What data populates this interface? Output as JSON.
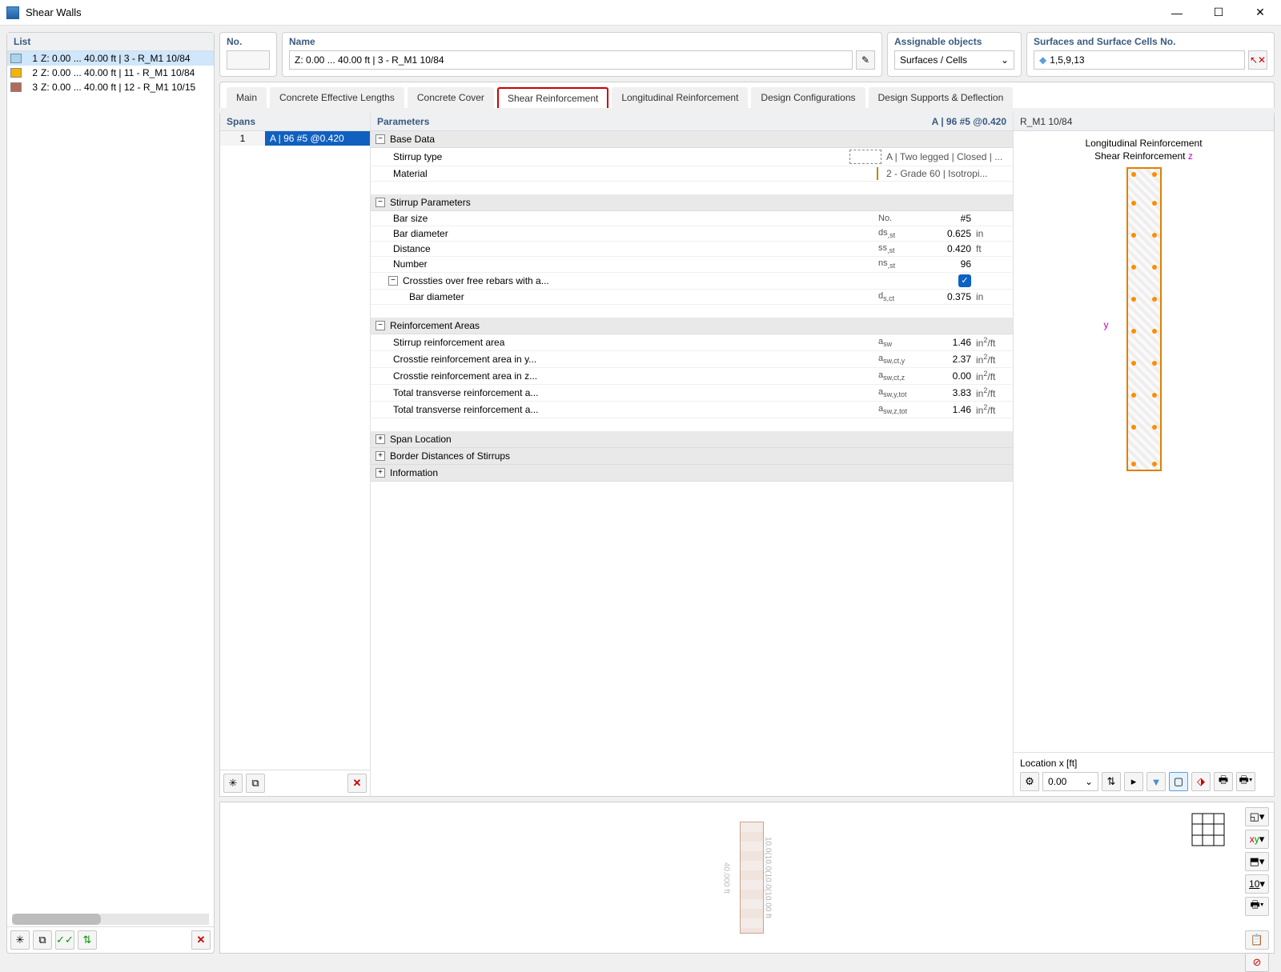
{
  "window": {
    "title": "Shear Walls"
  },
  "list": {
    "header": "List",
    "items": [
      {
        "num": "1",
        "color": "#a8d4f0",
        "label": "Z: 0.00 ... 40.00 ft | 3 - R_M1 10/84",
        "selected": true
      },
      {
        "num": "2",
        "color": "#f5b400",
        "label": "Z: 0.00 ... 40.00 ft | 11 - R_M1 10/84",
        "selected": false
      },
      {
        "num": "3",
        "color": "#b36a58",
        "label": "Z: 0.00 ... 40.00 ft | 12 - R_M1 10/15",
        "selected": false
      }
    ]
  },
  "fields": {
    "no_label": "No.",
    "no_value": "",
    "name_label": "Name",
    "name_value": "Z: 0.00 ... 40.00  ft | 3 - R_M1 10/84",
    "assign_label": "Assignable objects",
    "assign_value": "Surfaces / Cells",
    "surf_label": "Surfaces and Surface Cells No.",
    "surf_value": "1,5,9,13"
  },
  "tabs": [
    "Main",
    "Concrete Effective Lengths",
    "Concrete Cover",
    "Shear Reinforcement",
    "Longitudinal Reinforcement",
    "Design Configurations",
    "Design Supports & Deflection"
  ],
  "active_tab": "Shear Reinforcement",
  "spans": {
    "header": "Spans",
    "rows": [
      {
        "num": "1",
        "value": "A | 96 #5 @0.420"
      }
    ]
  },
  "params": {
    "header": "Parameters",
    "header_right": "A | 96 #5 @0.420",
    "base_data": {
      "title": "Base Data",
      "stirrup_type_label": "Stirrup type",
      "stirrup_type_value": "A | Two legged | Closed | ...",
      "material_label": "Material",
      "material_value": "2 - Grade 60 | Isotropi..."
    },
    "stirrup_params": {
      "title": "Stirrup Parameters",
      "rows": [
        {
          "name": "Bar size",
          "sym": "No.",
          "val": "#5",
          "unit": ""
        },
        {
          "name": "Bar diameter",
          "sym": "ds,st",
          "val": "0.625",
          "unit": "in"
        },
        {
          "name": "Distance",
          "sym": "ss,st",
          "val": "0.420",
          "unit": "ft"
        },
        {
          "name": "Number",
          "sym": "ns,st",
          "val": "96",
          "unit": ""
        }
      ],
      "crossties_label": "Crossties over free rebars with a...",
      "crossties_bar_label": "Bar diameter",
      "crossties_bar_sym": "ds,ct",
      "crossties_bar_val": "0.375",
      "crossties_bar_unit": "in"
    },
    "reinf_areas": {
      "title": "Reinforcement Areas",
      "rows": [
        {
          "name": "Stirrup reinforcement area",
          "sym": "asw",
          "val": "1.46",
          "unit": "in²/ft"
        },
        {
          "name": "Crosstie reinforcement area in y...",
          "sym": "asw,ct,y",
          "val": "2.37",
          "unit": "in²/ft"
        },
        {
          "name": "Crosstie reinforcement area in z...",
          "sym": "asw,ct,z",
          "val": "0.00",
          "unit": "in²/ft"
        },
        {
          "name": "Total transverse reinforcement a...",
          "sym": "asw,y,tot",
          "val": "3.83",
          "unit": "in²/ft"
        },
        {
          "name": "Total transverse reinforcement a...",
          "sym": "asw,z,tot",
          "val": "1.46",
          "unit": "in²/ft"
        }
      ]
    },
    "collapsed": [
      "Span Location",
      "Border Distances of Stirrups",
      "Information"
    ]
  },
  "preview": {
    "title": "R_M1 10/84",
    "label1": "Longitudinal Reinforcement",
    "label2": "Shear Reinforcement",
    "axis_z": "z",
    "axis_y": "y",
    "location_label": "Location x [ft]",
    "location_value": "0.00"
  }
}
